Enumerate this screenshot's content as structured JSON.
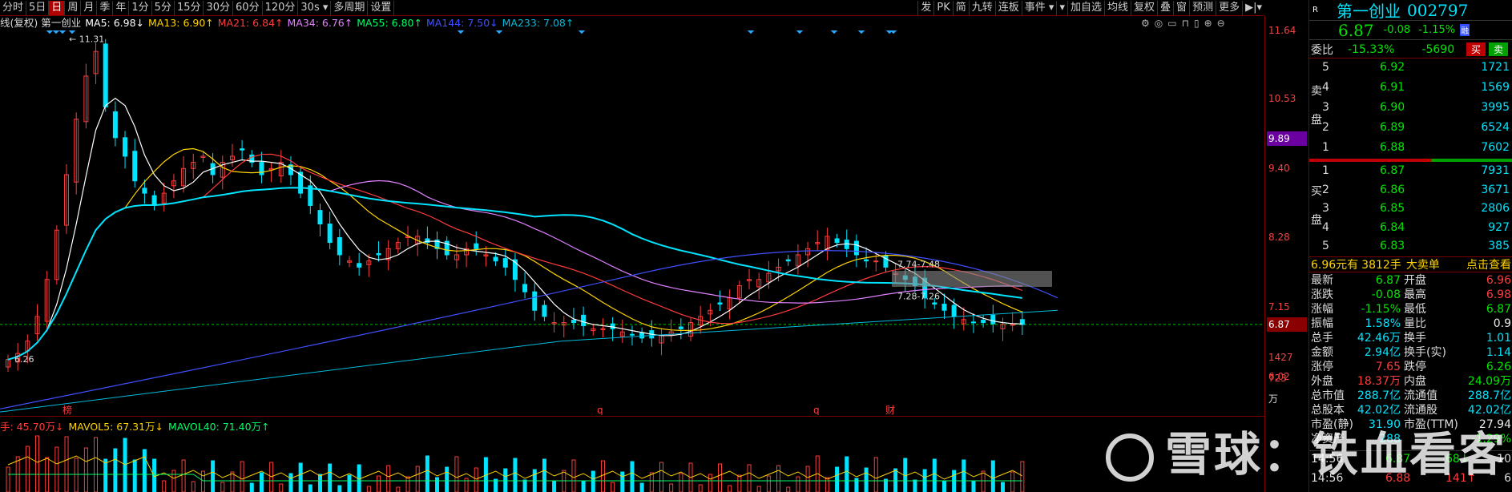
{
  "toolbar": {
    "tabs": [
      "分时",
      "5日",
      "日",
      "周",
      "月",
      "季",
      "年",
      "1分",
      "5分",
      "15分",
      "30分",
      "60分",
      "120分",
      "30s ▾",
      "多周期",
      "设置"
    ],
    "active_index": 2,
    "right_items": [
      "发",
      "PK",
      "简",
      "九转",
      "连板",
      "事件 ▾",
      "▾",
      "加自选",
      "均线",
      "复权",
      "叠",
      "窗",
      "预测",
      "更多",
      "▶|▾"
    ]
  },
  "ma_legend": {
    "prefix": "线(复权) 第一创业",
    "items": [
      {
        "text": "MA5: 6.98↓",
        "color": "#ffffff"
      },
      {
        "text": "MA13: 6.90↑",
        "color": "#ffd400"
      },
      {
        "text": "MA21: 6.84↑",
        "color": "#ff3c3c"
      },
      {
        "text": "MA34: 6.76↑",
        "color": "#e080ff"
      },
      {
        "text": "MA55: 6.80↑",
        "color": "#00ff66"
      },
      {
        "text": "MA144: 7.50↓",
        "color": "#4050ff"
      },
      {
        "text": "MA233: 7.08↑",
        "color": "#00bbdd"
      }
    ]
  },
  "chart_data": {
    "type": "candlestick",
    "y_ticks": [
      "11.64",
      "10.53",
      "9.89",
      "9.40",
      "8.28",
      "7.15",
      "6.87",
      "6.02"
    ],
    "ylim": [
      5.4,
      11.64
    ],
    "current_price": 6.87,
    "highlight_price": 9.89,
    "annotations": [
      "11.31",
      "6.26",
      "7.74-7.48",
      "7.28-7.26"
    ],
    "bottom_markers": [
      "榜",
      "q",
      "q",
      "财"
    ],
    "closes": [
      6.3,
      6.4,
      6.6,
      7.0,
      7.6,
      8.4,
      9.3,
      10.2,
      10.9,
      11.3,
      10.4,
      9.9,
      9.6,
      9.2,
      9.0,
      8.8,
      9.0,
      9.2,
      9.4,
      9.5,
      9.6,
      9.3,
      9.5,
      9.6,
      9.7,
      9.5,
      9.3,
      9.4,
      9.5,
      9.3,
      9.0,
      8.8,
      8.5,
      8.2,
      8.0,
      7.9,
      7.8,
      7.9,
      8.0,
      8.1,
      8.2,
      8.3,
      8.3,
      8.2,
      8.1,
      8.0,
      8.0,
      8.1,
      8.1,
      8.0,
      7.9,
      7.8,
      7.6,
      7.4,
      7.1,
      7.0,
      6.9,
      6.9,
      6.9,
      6.85,
      6.8,
      6.8,
      6.8,
      6.75,
      6.7,
      6.65,
      6.65,
      6.7,
      6.75,
      6.8,
      6.9,
      7.0,
      7.1,
      7.2,
      7.3,
      7.5,
      7.6,
      7.6,
      7.7,
      7.8,
      7.9,
      8.0,
      8.1,
      8.2,
      8.3,
      8.2,
      8.1,
      8.0,
      7.9,
      7.9,
      7.8,
      7.7,
      7.6,
      7.5,
      7.3,
      7.2,
      7.1,
      7.0,
      6.95,
      6.9,
      6.9,
      6.88,
      6.87,
      6.87,
      6.87
    ],
    "vol_ticks": [
      "1427",
      "723",
      "万"
    ]
  },
  "vol_legend": {
    "items": [
      {
        "text": "手: 45.70万↓",
        "color": "#ff3c3c"
      },
      {
        "text": "MAVOL5: 67.31万↓",
        "color": "#ffd400"
      },
      {
        "text": "MAVOL40: 71.40万↑",
        "color": "#00ff66"
      }
    ]
  },
  "quote": {
    "badge": "R",
    "name": "第一创业",
    "code": "002797",
    "price": "6.87",
    "change": "-0.08",
    "pct": "-1.15%",
    "flag": "融",
    "weibi_label": "委比",
    "weibi": "-15.33%",
    "weicha": "-5690",
    "buy_btn": "买",
    "sell_btn": "卖",
    "sell_label": "卖盘",
    "buy_label": "买盘",
    "asks": [
      {
        "lvl": "5",
        "price": "6.92",
        "vol": "1721"
      },
      {
        "lvl": "4",
        "price": "6.91",
        "vol": "1569"
      },
      {
        "lvl": "3",
        "price": "6.90",
        "vol": "3995"
      },
      {
        "lvl": "2",
        "price": "6.89",
        "vol": "6524"
      },
      {
        "lvl": "1",
        "price": "6.88",
        "vol": "7602"
      }
    ],
    "bids": [
      {
        "lvl": "1",
        "price": "6.87",
        "vol": "7931"
      },
      {
        "lvl": "2",
        "price": "6.86",
        "vol": "3671"
      },
      {
        "lvl": "3",
        "price": "6.85",
        "vol": "2806"
      },
      {
        "lvl": "4",
        "price": "6.84",
        "vol": "927"
      },
      {
        "lvl": "5",
        "price": "6.83",
        "vol": "385"
      }
    ],
    "big_order": {
      "price": "6.96元有",
      "hands": "3812手",
      "type": "大卖单",
      "link": "点击查看"
    },
    "stats": [
      {
        "l1": "最新",
        "v1": "6.87",
        "c1": "grn",
        "l2": "开盘",
        "v2": "6.96",
        "c2": "red"
      },
      {
        "l1": "涨跌",
        "v1": "-0.08",
        "c1": "grn",
        "l2": "最高",
        "v2": "6.98",
        "c2": "red"
      },
      {
        "l1": "涨幅",
        "v1": "-1.15%",
        "c1": "grn",
        "l2": "最低",
        "v2": "6.87",
        "c2": "grn"
      },
      {
        "l1": "振幅",
        "v1": "1.58%",
        "c1": "cyan",
        "l2": "量比",
        "v2": "0.9",
        "c2": "wht"
      },
      {
        "l1": "总手",
        "v1": "42.46万",
        "c1": "cyan",
        "l2": "换手",
        "v2": "1.01",
        "c2": "cyan"
      },
      {
        "l1": "金额",
        "v1": "2.94亿",
        "c1": "cyan",
        "l2": "换手(实)",
        "v2": "1.14",
        "c2": "cyan"
      },
      {
        "l1": "涨停",
        "v1": "7.65",
        "c1": "red",
        "l2": "跌停",
        "v2": "6.26",
        "c2": "grn"
      },
      {
        "l1": "外盘",
        "v1": "18.37万",
        "c1": "red",
        "l2": "内盘",
        "v2": "24.09万",
        "c2": "grn"
      },
      {
        "l1": "总市值",
        "v1": "288.7亿",
        "c1": "cyan",
        "l2": "流通值",
        "v2": "288.7亿",
        "c2": "cyan"
      },
      {
        "l1": "总股本",
        "v1": "42.02亿",
        "c1": "cyan",
        "l2": "流通股",
        "v2": "42.02亿",
        "c2": "cyan"
      },
      {
        "l1": "市盈(静)",
        "v1": "31.90",
        "c1": "cyan",
        "l2": "市盈(TTM)",
        "v2": "27.94",
        "c2": "wht"
      },
      {
        "l1": "净资产",
        "v1": "288",
        "c1": "cyan",
        "l2": "",
        "v2": "-1.29%",
        "c2": "grn"
      }
    ],
    "ticks": [
      {
        "time": "14:56",
        "price": "6.87",
        "vol": "68",
        "dir": "↓",
        "n": "10"
      },
      {
        "time": "14:56",
        "price": "6.88",
        "vol": "141",
        "dir": "↑",
        "n": "6"
      }
    ]
  },
  "watermark": "雪球：铁血看客"
}
